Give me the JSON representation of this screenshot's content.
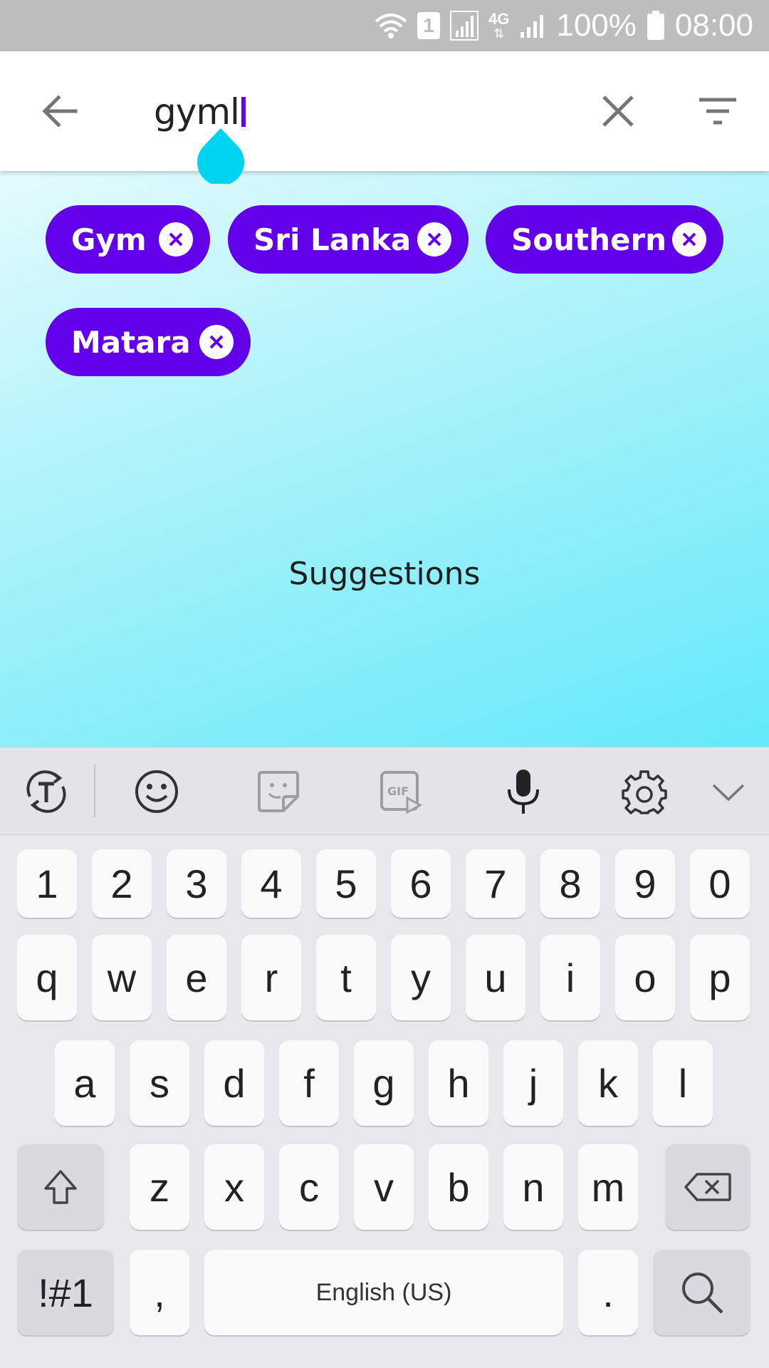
{
  "status_bar": {
    "sim_badge": "1",
    "network_type": "4G",
    "battery_percent": "100%",
    "time": "08:00"
  },
  "search": {
    "query": "gyml"
  },
  "chips": [
    {
      "label": "Gym"
    },
    {
      "label": "Sri Lanka"
    },
    {
      "label": "Southern"
    },
    {
      "label": "Matara"
    }
  ],
  "content": {
    "suggestions_label": "Suggestions"
  },
  "keyboard": {
    "toolbar_icons": [
      "text-translate-icon",
      "emoji-icon",
      "sticker-icon",
      "gif-icon",
      "microphone-icon",
      "gear-icon",
      "chevron-down-icon"
    ],
    "number_row": [
      "1",
      "2",
      "3",
      "4",
      "5",
      "6",
      "7",
      "8",
      "9",
      "0"
    ],
    "row1": [
      "q",
      "w",
      "e",
      "r",
      "t",
      "y",
      "u",
      "i",
      "o",
      "p"
    ],
    "row2": [
      "a",
      "s",
      "d",
      "f",
      "g",
      "h",
      "j",
      "k",
      "l"
    ],
    "row3": [
      "z",
      "x",
      "c",
      "v",
      "b",
      "n",
      "m"
    ],
    "symbols_label": "!#1",
    "comma_label": ",",
    "space_label": "English (US)",
    "period_label": "."
  },
  "colors": {
    "accent": "#6200ea",
    "status_bar": "#bdbdbd",
    "cursor_handle": "#00d4f0"
  }
}
